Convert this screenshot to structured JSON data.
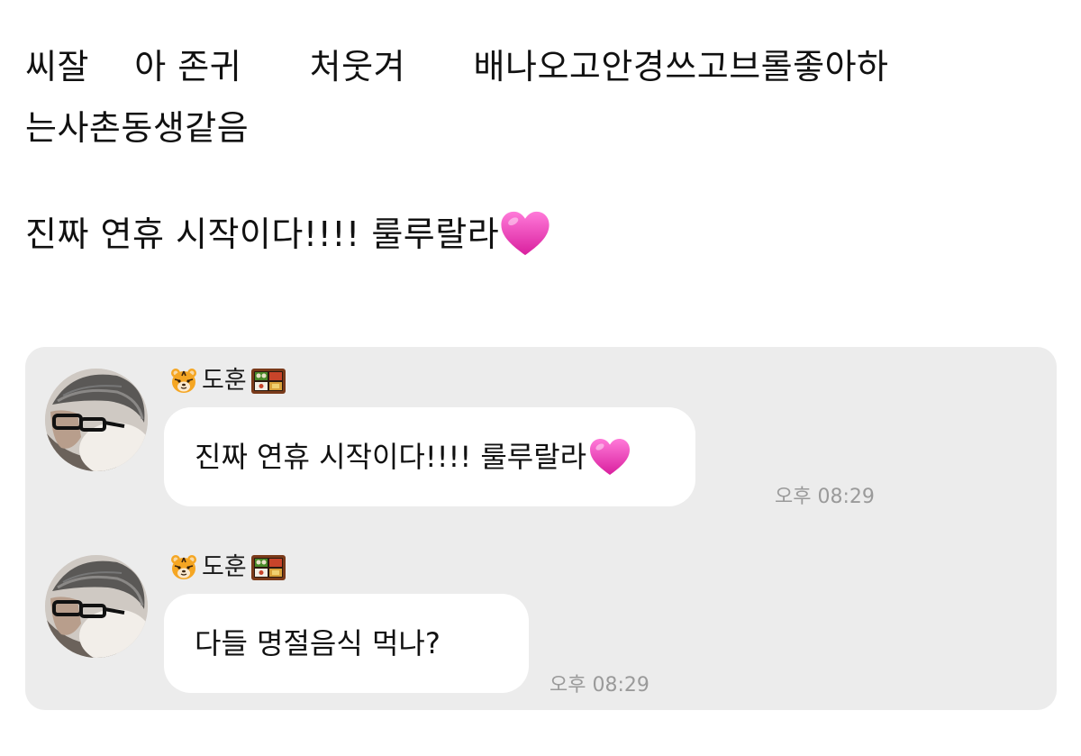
{
  "post": {
    "line1": "씨잘    아 존귀      처웃겨      배나오고안경쓰고브롤좋아하",
    "line2": "는사촌동생같음",
    "line3": "진짜 연휴 시작이다!!!! 룰루랄라",
    "heart_emoji": "pink-heart-icon"
  },
  "chat": {
    "messages": [
      {
        "sender": "도훈",
        "sender_prefix_icon": "tiger-face-icon",
        "sender_suffix_icon": "bento-box-icon",
        "text": "진짜 연휴 시작이다!!!! 룰루랄라",
        "time": "오후 08:29",
        "trailing_icon": "pink-heart-icon"
      },
      {
        "sender": "도훈",
        "sender_prefix_icon": "tiger-face-icon",
        "sender_suffix_icon": "bento-box-icon",
        "text": "다들 명절음식 먹나?",
        "time": "오후 08:29"
      }
    ]
  },
  "colors": {
    "card_bg": "#ececec",
    "bubble_bg": "#ffffff",
    "time_text": "#9a9a9a",
    "heart": "#e83fb2"
  }
}
